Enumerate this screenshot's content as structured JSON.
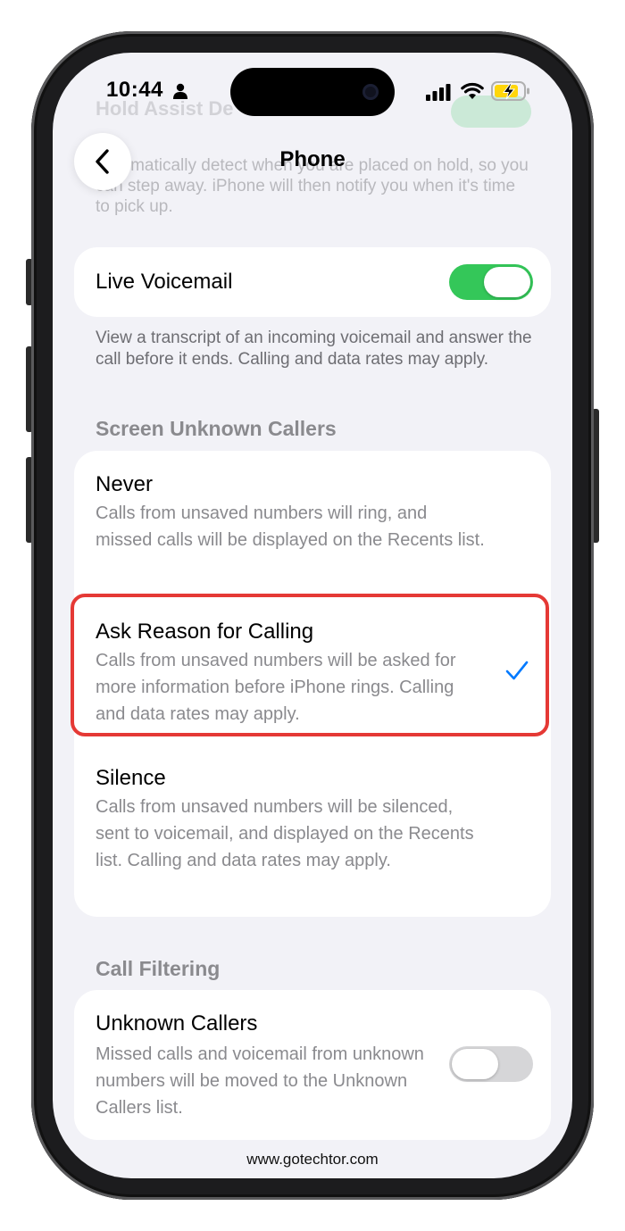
{
  "status_bar": {
    "time": "10:44",
    "icons": [
      "person-icon",
      "signal-icon",
      "wifi-icon",
      "battery-charging-icon"
    ]
  },
  "faded_content": {
    "title": "Hold Assist De",
    "description": "Automatically detect when you are placed on hold, so you can step away. iPhone will then notify you when it's time to pick up."
  },
  "nav": {
    "title": "Phone",
    "back_icon": "chevron-left-icon"
  },
  "live_voicemail": {
    "label": "Live Voicemail",
    "toggle_on": true,
    "footnote": "View a transcript of an incoming voicemail and answer the call before it ends. Calling and data rates may apply."
  },
  "screen_unknown_callers": {
    "header": "Screen Unknown Callers",
    "options": [
      {
        "title": "Never",
        "description": "Calls from unsaved numbers will ring, and missed calls will be displayed on the Recents list.",
        "selected": false
      },
      {
        "title": "Ask Reason for Calling",
        "description": "Calls from unsaved numbers will be asked for more information before iPhone rings. Calling and data rates may apply.",
        "selected": true
      },
      {
        "title": "Silence",
        "description": "Calls from unsaved numbers will be silenced, sent to voicemail, and displayed on the Recents list. Calling and data rates may apply.",
        "selected": false
      }
    ]
  },
  "call_filtering": {
    "header": "Call Filtering",
    "unknown_callers": {
      "title": "Unknown Callers",
      "description": "Missed calls and voicemail from unknown numbers will be moved to the Unknown Callers list.",
      "toggle_on": false
    }
  },
  "watermark": "www.gotechtor.com",
  "colors": {
    "accent": "#007aff",
    "toggle_on": "#34c759",
    "highlight": "#e53935",
    "background": "#f2f2f7"
  }
}
